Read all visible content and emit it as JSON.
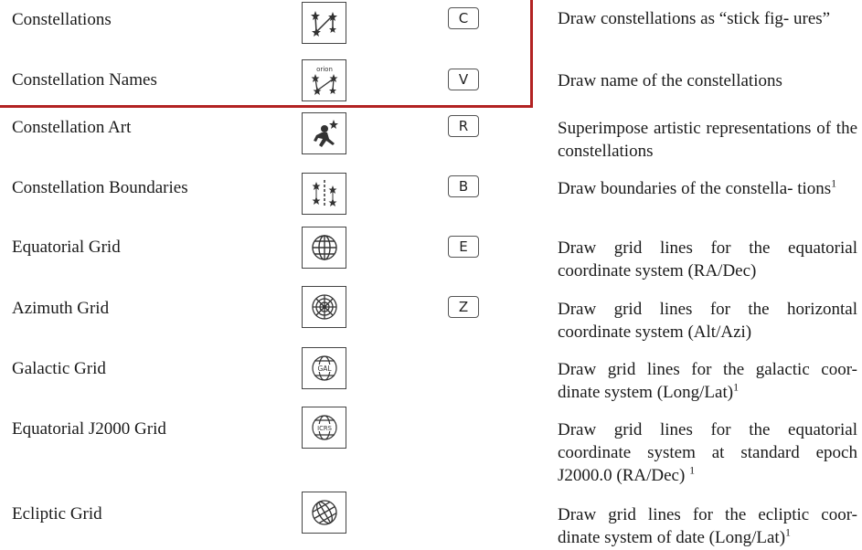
{
  "rows": [
    {
      "name": "Constellations",
      "key": "C",
      "icon": "constellation-lines-icon",
      "desc": "Draw constellations as “stick fig- ures”",
      "note": ""
    },
    {
      "name": "Constellation Names",
      "key": "V",
      "icon": "constellation-names-icon",
      "desc": "Draw name of the constellations",
      "note": ""
    },
    {
      "name": "Constellation Art",
      "key": "R",
      "icon": "constellation-art-icon",
      "desc": "Superimpose artistic representations of the constellations",
      "note": ""
    },
    {
      "name": "Constellation Boundaries",
      "key": "B",
      "icon": "constellation-boundaries-icon",
      "desc": "Draw boundaries of the constella- tions",
      "note": "1"
    },
    {
      "name": "Equatorial Grid",
      "key": "E",
      "icon": "equatorial-grid-icon",
      "desc": "Draw grid lines for the equatorial coordinate system (RA/Dec)",
      "note": ""
    },
    {
      "name": "Azimuth Grid",
      "key": "Z",
      "icon": "azimuth-grid-icon",
      "desc": "Draw grid lines for the horizontal coordinate system (Alt/Azi)",
      "note": ""
    },
    {
      "name": "Galactic Grid",
      "key": "",
      "icon": "galactic-grid-icon",
      "desc": "Draw grid lines for the galactic coor- dinate system (Long/Lat)",
      "note": "1"
    },
    {
      "name": "Equatorial J2000 Grid",
      "key": "",
      "icon": "equatorial-j2000-grid-icon",
      "desc": "Draw grid lines for the equatorial coordinate system at standard epoch J2000.0 (RA/Dec) ",
      "note": "1"
    },
    {
      "name": "Ecliptic Grid",
      "key": "",
      "icon": "ecliptic-grid-icon",
      "desc": "Draw grid lines for the ecliptic coor- dinate system of date (Long/Lat)",
      "note": "1"
    }
  ],
  "icon_text": {
    "names": "orion",
    "galactic": "GAL",
    "icrs": "ICRS"
  },
  "colors": {
    "highlight": "#b22222",
    "text": "#1a1a1a"
  }
}
